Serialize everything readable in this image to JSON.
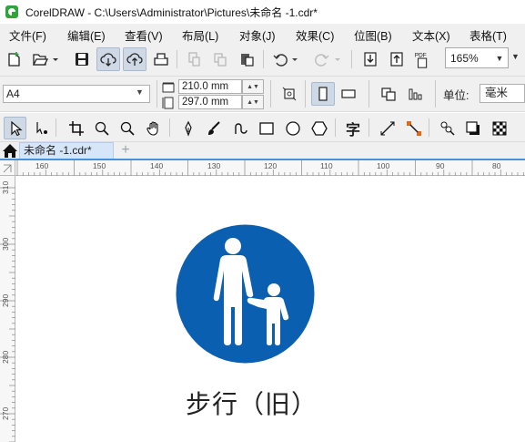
{
  "window": {
    "title": "CorelDRAW - C:\\Users\\Administrator\\Pictures\\未命名 -1.cdr*"
  },
  "menu": {
    "items": [
      {
        "label": "文件(F)"
      },
      {
        "label": "编辑(E)"
      },
      {
        "label": "查看(V)"
      },
      {
        "label": "布局(L)"
      },
      {
        "label": "对象(J)"
      },
      {
        "label": "效果(C)"
      },
      {
        "label": "位图(B)"
      },
      {
        "label": "文本(X)"
      },
      {
        "label": "表格(T)"
      }
    ]
  },
  "toolbar": {
    "zoom_value": "165%",
    "pdf_label": "PDF"
  },
  "property_bar": {
    "page_size": "A4",
    "width_value": "210.0 mm",
    "height_value": "297.0 mm",
    "units_label": "单位:",
    "units_value": "毫米"
  },
  "toolbox": {
    "text_tool_glyph": "字"
  },
  "tabs": {
    "document_tab": "未命名 -1.cdr*",
    "add_tab": "+"
  },
  "rulers": {
    "horizontal_labels": [
      "160",
      "150",
      "140",
      "130",
      "120",
      "110",
      "100",
      "90",
      "80"
    ],
    "vertical_labels": [
      "310",
      "300",
      "290",
      "280",
      "270"
    ]
  },
  "canvas": {
    "sign_caption": "步行（旧）",
    "sign_color": "#0a5fb0"
  },
  "colors": {
    "accent": "#4a90d9",
    "active_button": "#cfd9e6",
    "tab_bg": "#d6e6f8"
  }
}
